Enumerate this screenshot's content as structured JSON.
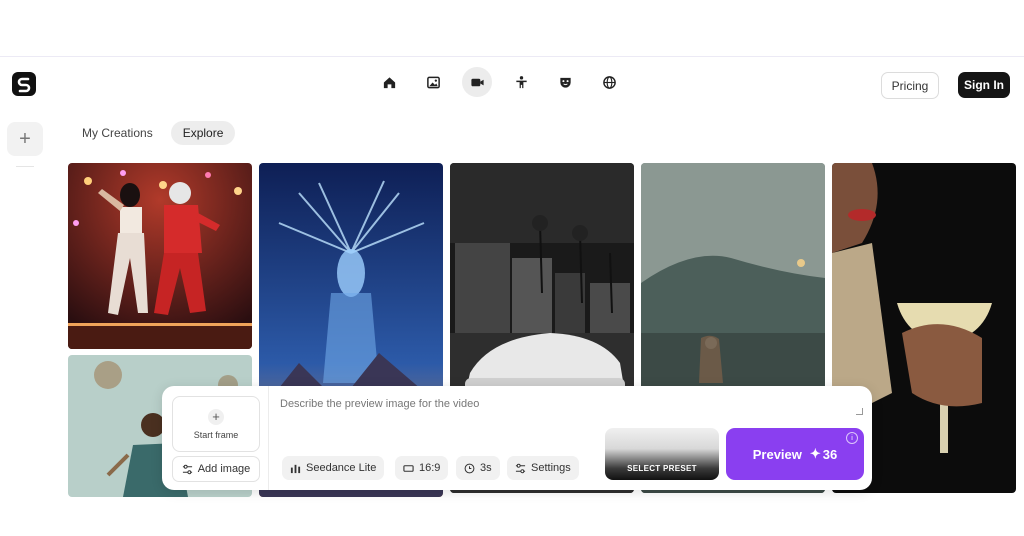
{
  "header": {
    "logo_icon": "s-logo-icon",
    "nav_icons": [
      "home-icon",
      "image-icon",
      "video-icon",
      "character-icon",
      "mask-icon",
      "globe-icon"
    ],
    "active_nav": "video-icon",
    "pricing_label": "Pricing",
    "signin_label": "Sign In"
  },
  "sidebar": {
    "add_icon": "plus-icon"
  },
  "tabs": [
    {
      "label": "My Creations",
      "active": false
    },
    {
      "label": "Explore",
      "active": true
    }
  ],
  "composer": {
    "start_frame_label": "Start frame",
    "add_image_label": "Add image",
    "prompt_placeholder": "Describe the preview image for the video",
    "model_label": "Seedance Lite",
    "aspect_label": "16:9",
    "duration_label": "3s",
    "settings_label": "Settings",
    "preset_label": "SELECT PRESET",
    "preview_label": "Preview",
    "preview_cost": "36",
    "accent_color": "#8a3ff0"
  }
}
